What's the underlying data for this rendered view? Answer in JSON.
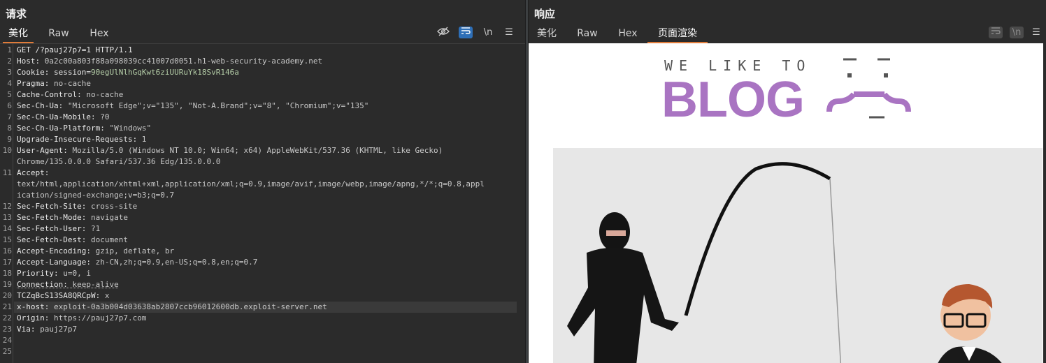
{
  "request": {
    "title": "请求",
    "tabs": [
      {
        "label": "美化",
        "active": true
      },
      {
        "label": "Raw",
        "active": false
      },
      {
        "label": "Hex",
        "active": false
      }
    ],
    "tools": {
      "newline_label": "\\n"
    },
    "lines": [
      {
        "n": "1",
        "key": "GET /?pauj27p7=1 HTTP/1.1",
        "val": ""
      },
      {
        "n": "2",
        "key": "Host:",
        "val": " 0a2c00a803f88a098039cc41007d0051.h1-web-security-academy.net"
      },
      {
        "n": "3",
        "key": "Cookie: session=",
        "val": "90egUlNlhGqKwt6ziUURuYk18SvR146a"
      },
      {
        "n": "4",
        "key": "Pragma:",
        "val": " no-cache"
      },
      {
        "n": "5",
        "key": "Cache-Control:",
        "val": " no-cache"
      },
      {
        "n": "6",
        "key": "Sec-Ch-Ua:",
        "val": " \"Microsoft Edge\";v=\"135\", \"Not-A.Brand\";v=\"8\", \"Chromium\";v=\"135\""
      },
      {
        "n": "7",
        "key": "Sec-Ch-Ua-Mobile:",
        "val": " ?0"
      },
      {
        "n": "8",
        "key": "Sec-Ch-Ua-Platform:",
        "val": " \"Windows\""
      },
      {
        "n": "9",
        "key": "Upgrade-Insecure-Requests:",
        "val": " 1"
      },
      {
        "n": "10",
        "key": "User-Agent:",
        "val": " Mozilla/5.0 (Windows NT 10.0; Win64; x64) AppleWebKit/537.36 (KHTML, like Gecko)"
      },
      {
        "n": "",
        "key": "",
        "val": "Chrome/135.0.0.0 Safari/537.36 Edg/135.0.0.0"
      },
      {
        "n": "11",
        "key": "Accept:",
        "val": ""
      },
      {
        "n": "",
        "key": "",
        "val": "text/html,application/xhtml+xml,application/xml;q=0.9,image/avif,image/webp,image/apng,*/*;q=0.8,appl"
      },
      {
        "n": "",
        "key": "",
        "val": "ication/signed-exchange;v=b3;q=0.7"
      },
      {
        "n": "12",
        "key": "Sec-Fetch-Site:",
        "val": " cross-site"
      },
      {
        "n": "13",
        "key": "Sec-Fetch-Mode:",
        "val": " navigate"
      },
      {
        "n": "14",
        "key": "Sec-Fetch-User:",
        "val": " ?1"
      },
      {
        "n": "15",
        "key": "Sec-Fetch-Dest:",
        "val": " document"
      },
      {
        "n": "16",
        "key": "Accept-Encoding:",
        "val": " gzip, deflate, br"
      },
      {
        "n": "17",
        "key": "Accept-Language:",
        "val": " zh-CN,zh;q=0.9,en-US;q=0.8,en;q=0.7"
      },
      {
        "n": "18",
        "key": "Priority:",
        "val": " u=0, i"
      },
      {
        "n": "19",
        "key": "Connection:",
        "val": " keep-alive"
      },
      {
        "n": "20",
        "key": "TCZqBcS13SA8QRCpW:",
        "val": " x"
      },
      {
        "n": "21",
        "key": "x-host:",
        "val": " exploit-0a3b004d03638ab2807ccb96012600db.exploit-server.net"
      },
      {
        "n": "22",
        "key": "Origin:",
        "val": " https://pauj27p7.com"
      },
      {
        "n": "23",
        "key": "Via:",
        "val": " pauj27p7"
      },
      {
        "n": "24",
        "key": "",
        "val": ""
      },
      {
        "n": "25",
        "key": "",
        "val": ""
      }
    ]
  },
  "response": {
    "title": "响应",
    "tabs": [
      {
        "label": "美化",
        "active": false
      },
      {
        "label": "Raw",
        "active": false
      },
      {
        "label": "Hex",
        "active": false
      },
      {
        "label": "页面渲染",
        "active": true
      }
    ],
    "tools": {
      "newline_label": "\\n"
    },
    "render": {
      "tagline": "WE LIKE TO",
      "brand": "BLOG",
      "brand_color": "#a974c2"
    }
  },
  "colors": {
    "accent": "#e07b39",
    "toggle_on": "#2e6fb7",
    "cookie_value": "#b5cea8"
  }
}
